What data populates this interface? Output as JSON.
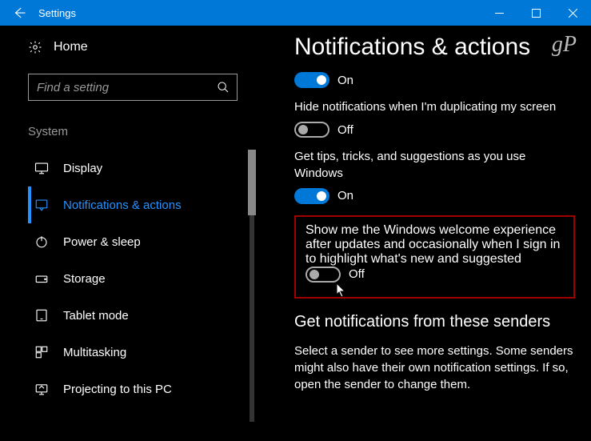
{
  "titlebar": {
    "title": "Settings"
  },
  "sidebar": {
    "home": "Home",
    "search_placeholder": "Find a setting",
    "group": "System",
    "items": [
      {
        "label": "Display"
      },
      {
        "label": "Notifications & actions"
      },
      {
        "label": "Power & sleep"
      },
      {
        "label": "Storage"
      },
      {
        "label": "Tablet mode"
      },
      {
        "label": "Multitasking"
      },
      {
        "label": "Projecting to this PC"
      }
    ]
  },
  "main": {
    "heading": "Notifications & actions",
    "settings": [
      {
        "state": "On"
      },
      {
        "label": "Hide notifications when I'm duplicating my screen",
        "state": "Off"
      },
      {
        "label": "Get tips, tricks, and suggestions as you use Windows",
        "state": "On"
      },
      {
        "label": "Show me the Windows welcome experience after updates and occasionally when I sign in to highlight what's new and suggested",
        "state": "Off"
      }
    ],
    "subheading": "Get notifications from these senders",
    "description": "Select a sender to see more settings. Some senders might also have their own notification settings. If so, open the sender to change them."
  },
  "watermark": "gP"
}
